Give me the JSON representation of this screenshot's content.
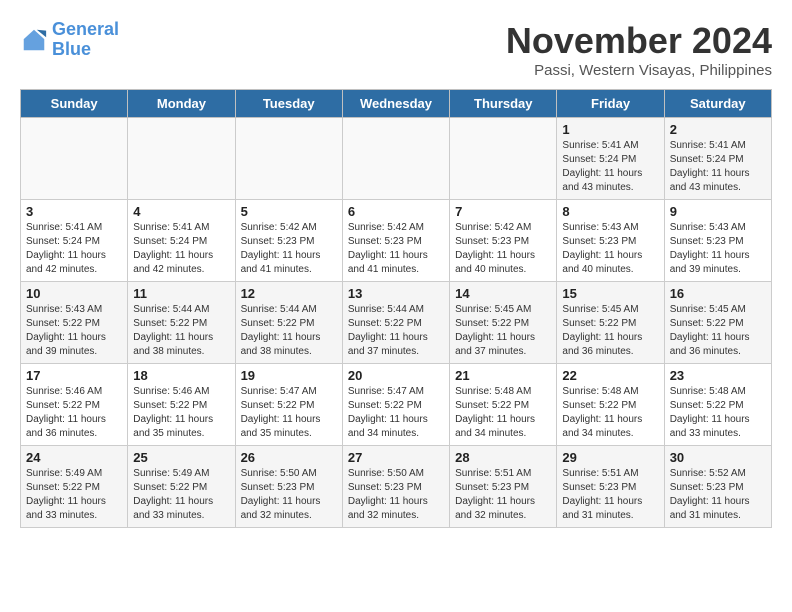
{
  "header": {
    "logo_line1": "General",
    "logo_line2": "Blue",
    "month_title": "November 2024",
    "location": "Passi, Western Visayas, Philippines"
  },
  "days_of_week": [
    "Sunday",
    "Monday",
    "Tuesday",
    "Wednesday",
    "Thursday",
    "Friday",
    "Saturday"
  ],
  "weeks": [
    [
      {
        "day": "",
        "info": ""
      },
      {
        "day": "",
        "info": ""
      },
      {
        "day": "",
        "info": ""
      },
      {
        "day": "",
        "info": ""
      },
      {
        "day": "",
        "info": ""
      },
      {
        "day": "1",
        "info": "Sunrise: 5:41 AM\nSunset: 5:24 PM\nDaylight: 11 hours\nand 43 minutes."
      },
      {
        "day": "2",
        "info": "Sunrise: 5:41 AM\nSunset: 5:24 PM\nDaylight: 11 hours\nand 43 minutes."
      }
    ],
    [
      {
        "day": "3",
        "info": "Sunrise: 5:41 AM\nSunset: 5:24 PM\nDaylight: 11 hours\nand 42 minutes."
      },
      {
        "day": "4",
        "info": "Sunrise: 5:41 AM\nSunset: 5:24 PM\nDaylight: 11 hours\nand 42 minutes."
      },
      {
        "day": "5",
        "info": "Sunrise: 5:42 AM\nSunset: 5:23 PM\nDaylight: 11 hours\nand 41 minutes."
      },
      {
        "day": "6",
        "info": "Sunrise: 5:42 AM\nSunset: 5:23 PM\nDaylight: 11 hours\nand 41 minutes."
      },
      {
        "day": "7",
        "info": "Sunrise: 5:42 AM\nSunset: 5:23 PM\nDaylight: 11 hours\nand 40 minutes."
      },
      {
        "day": "8",
        "info": "Sunrise: 5:43 AM\nSunset: 5:23 PM\nDaylight: 11 hours\nand 40 minutes."
      },
      {
        "day": "9",
        "info": "Sunrise: 5:43 AM\nSunset: 5:23 PM\nDaylight: 11 hours\nand 39 minutes."
      }
    ],
    [
      {
        "day": "10",
        "info": "Sunrise: 5:43 AM\nSunset: 5:22 PM\nDaylight: 11 hours\nand 39 minutes."
      },
      {
        "day": "11",
        "info": "Sunrise: 5:44 AM\nSunset: 5:22 PM\nDaylight: 11 hours\nand 38 minutes."
      },
      {
        "day": "12",
        "info": "Sunrise: 5:44 AM\nSunset: 5:22 PM\nDaylight: 11 hours\nand 38 minutes."
      },
      {
        "day": "13",
        "info": "Sunrise: 5:44 AM\nSunset: 5:22 PM\nDaylight: 11 hours\nand 37 minutes."
      },
      {
        "day": "14",
        "info": "Sunrise: 5:45 AM\nSunset: 5:22 PM\nDaylight: 11 hours\nand 37 minutes."
      },
      {
        "day": "15",
        "info": "Sunrise: 5:45 AM\nSunset: 5:22 PM\nDaylight: 11 hours\nand 36 minutes."
      },
      {
        "day": "16",
        "info": "Sunrise: 5:45 AM\nSunset: 5:22 PM\nDaylight: 11 hours\nand 36 minutes."
      }
    ],
    [
      {
        "day": "17",
        "info": "Sunrise: 5:46 AM\nSunset: 5:22 PM\nDaylight: 11 hours\nand 36 minutes."
      },
      {
        "day": "18",
        "info": "Sunrise: 5:46 AM\nSunset: 5:22 PM\nDaylight: 11 hours\nand 35 minutes."
      },
      {
        "day": "19",
        "info": "Sunrise: 5:47 AM\nSunset: 5:22 PM\nDaylight: 11 hours\nand 35 minutes."
      },
      {
        "day": "20",
        "info": "Sunrise: 5:47 AM\nSunset: 5:22 PM\nDaylight: 11 hours\nand 34 minutes."
      },
      {
        "day": "21",
        "info": "Sunrise: 5:48 AM\nSunset: 5:22 PM\nDaylight: 11 hours\nand 34 minutes."
      },
      {
        "day": "22",
        "info": "Sunrise: 5:48 AM\nSunset: 5:22 PM\nDaylight: 11 hours\nand 34 minutes."
      },
      {
        "day": "23",
        "info": "Sunrise: 5:48 AM\nSunset: 5:22 PM\nDaylight: 11 hours\nand 33 minutes."
      }
    ],
    [
      {
        "day": "24",
        "info": "Sunrise: 5:49 AM\nSunset: 5:22 PM\nDaylight: 11 hours\nand 33 minutes."
      },
      {
        "day": "25",
        "info": "Sunrise: 5:49 AM\nSunset: 5:22 PM\nDaylight: 11 hours\nand 33 minutes."
      },
      {
        "day": "26",
        "info": "Sunrise: 5:50 AM\nSunset: 5:23 PM\nDaylight: 11 hours\nand 32 minutes."
      },
      {
        "day": "27",
        "info": "Sunrise: 5:50 AM\nSunset: 5:23 PM\nDaylight: 11 hours\nand 32 minutes."
      },
      {
        "day": "28",
        "info": "Sunrise: 5:51 AM\nSunset: 5:23 PM\nDaylight: 11 hours\nand 32 minutes."
      },
      {
        "day": "29",
        "info": "Sunrise: 5:51 AM\nSunset: 5:23 PM\nDaylight: 11 hours\nand 31 minutes."
      },
      {
        "day": "30",
        "info": "Sunrise: 5:52 AM\nSunset: 5:23 PM\nDaylight: 11 hours\nand 31 minutes."
      }
    ]
  ]
}
